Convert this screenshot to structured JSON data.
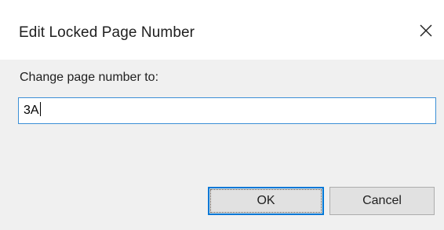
{
  "dialog": {
    "title": "Edit Locked Page Number",
    "close_icon": "close-icon"
  },
  "form": {
    "label": "Change page number to:",
    "value": "3A"
  },
  "buttons": {
    "ok_label": "OK",
    "cancel_label": "Cancel"
  },
  "colors": {
    "focus_border": "#0078d7",
    "input_border": "#3c8fd6",
    "dialog_background": "#f0f0f0"
  }
}
